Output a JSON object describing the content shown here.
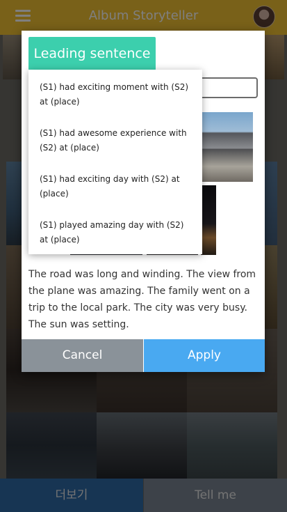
{
  "app": {
    "title": "Album Storyteller"
  },
  "bottom_bar": {
    "more_label": "더보기",
    "tell_label": "Tell me"
  },
  "modal": {
    "leading_sentence_label": "Leading sentence",
    "sentence_options": [
      "(S1) had exciting moment with (S2) at (place)",
      "(S1) had awesome experience with (S2) at (place)",
      "(S1) had exciting day with (S2) at (place)",
      "(S1) played amazing day with (S2) at (place)"
    ],
    "story_text": "The road was long and winding. The view from the plane was amazing. The family went on a trip to the local park. The city was very busy. The sun was setting.",
    "cancel_label": "Cancel",
    "apply_label": "Apply"
  },
  "colors": {
    "header": "#f2c233",
    "leading_button": "#3ccfad",
    "apply_button": "#49a9f1",
    "cancel_button": "#8a9299"
  },
  "icons": {
    "menu": "hamburger-icon",
    "profile": "avatar"
  }
}
